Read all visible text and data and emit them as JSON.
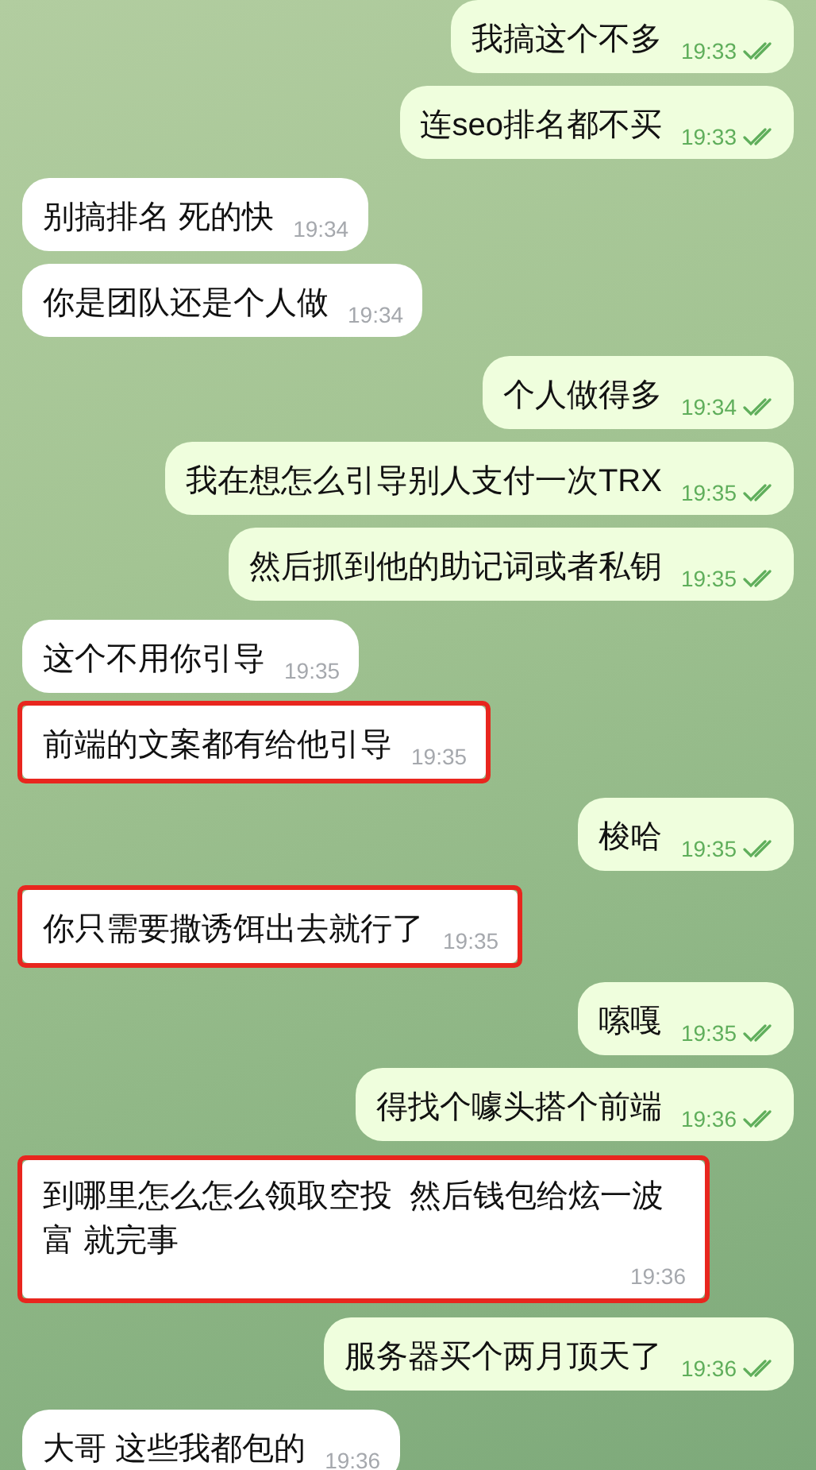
{
  "messages": [
    {
      "kind": "out",
      "text": "我搞这个不多",
      "time": "19:33",
      "read": true,
      "highlighted": false
    },
    {
      "kind": "out",
      "text": "连seo排名都不买",
      "time": "19:33",
      "read": true,
      "highlighted": false
    },
    {
      "kind": "in",
      "text": "别搞排名 死的快",
      "time": "19:34",
      "highlighted": false
    },
    {
      "kind": "in",
      "text": "你是团队还是个人做",
      "time": "19:34",
      "highlighted": false
    },
    {
      "kind": "out",
      "text": "个人做得多",
      "time": "19:34",
      "read": true,
      "highlighted": false
    },
    {
      "kind": "out",
      "text": "我在想怎么引导别人支付一次TRX",
      "time": "19:35",
      "read": true,
      "highlighted": false
    },
    {
      "kind": "out",
      "text": "然后抓到他的助记词或者私钥",
      "time": "19:35",
      "read": true,
      "highlighted": false
    },
    {
      "kind": "in",
      "text": "这个不用你引导",
      "time": "19:35",
      "highlighted": false
    },
    {
      "kind": "in",
      "text": "前端的文案都有给他引导",
      "time": "19:35",
      "highlighted": true
    },
    {
      "kind": "out",
      "text": "梭哈",
      "time": "19:35",
      "read": true,
      "highlighted": false
    },
    {
      "kind": "in",
      "text": "你只需要撒诱饵出去就行了",
      "time": "19:35",
      "highlighted": true
    },
    {
      "kind": "out",
      "text": "嗦嘎",
      "time": "19:35",
      "read": true,
      "highlighted": false
    },
    {
      "kind": "out",
      "text": "得找个噱头搭个前端",
      "time": "19:36",
      "read": true,
      "highlighted": false
    },
    {
      "kind": "in",
      "text": "到哪里怎么怎么领取空投  然后钱包给炫一波富 就完事",
      "time": "19:36",
      "highlighted": true
    },
    {
      "kind": "out",
      "text": "服务器买个两月顶天了",
      "time": "19:36",
      "read": true,
      "highlighted": false
    },
    {
      "kind": "in",
      "text": "大哥 这些我都包的",
      "time": "19:36",
      "highlighted": false
    }
  ]
}
